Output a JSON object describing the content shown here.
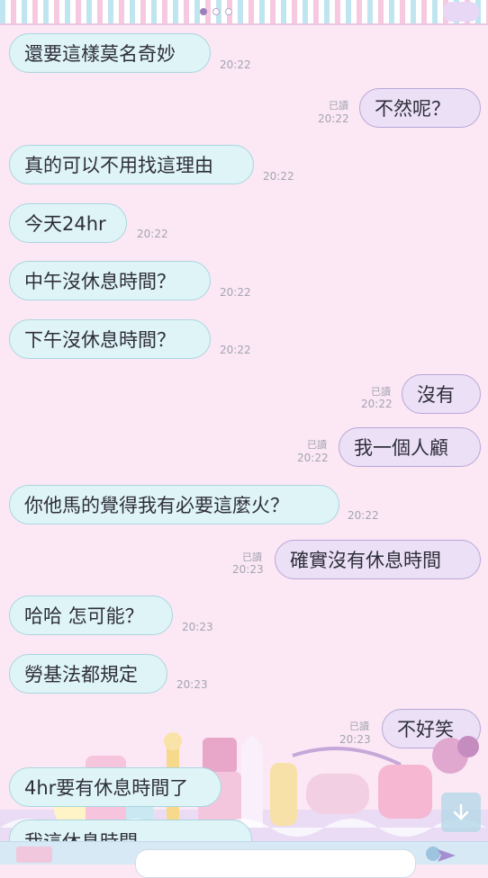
{
  "header": {
    "page_dots": 3,
    "active_dot": 0
  },
  "messages": [
    {
      "side": "in",
      "text": "還要這樣莫名奇妙",
      "time": "20:22"
    },
    {
      "side": "out",
      "text": "不然呢？",
      "read": "已讀",
      "time": "20:22"
    },
    {
      "side": "in",
      "text": "真的可以不用找這理由",
      "time": "20:22"
    },
    {
      "side": "in",
      "text": "今天24hr",
      "time": "20:22"
    },
    {
      "side": "in",
      "text": "中午沒休息時間？",
      "time": "20:22"
    },
    {
      "side": "in",
      "text": "下午沒休息時間？",
      "time": "20:22"
    },
    {
      "side": "out",
      "text": "沒有",
      "read": "已讀",
      "time": "20:22"
    },
    {
      "side": "out",
      "text": "我一個人顧",
      "read": "已讀",
      "time": "20:22"
    },
    {
      "side": "in",
      "text": "你他馬的覺得我有必要這麼火？",
      "time": "20:22"
    },
    {
      "side": "out",
      "text": "確實沒有休息時間",
      "read": "已讀",
      "time": "20:23"
    },
    {
      "side": "in",
      "text": "哈哈 怎可能？",
      "time": "20:23"
    },
    {
      "side": "in",
      "text": "勞基法都規定",
      "time": "20:23"
    },
    {
      "side": "out",
      "text": "不好笑",
      "read": "已讀",
      "time": "20:23"
    },
    {
      "side": "in",
      "text": "4hr要有休息時間了"
    },
    {
      "side": "in",
      "text": "我這休息時間..."
    }
  ],
  "icons": {
    "scroll_down": "arrow-down-icon",
    "send": "send-icon",
    "sticker": "sticker-icon"
  },
  "colors": {
    "background": "#fbe8f4",
    "incoming_bubble": "#dff4f7",
    "outgoing_bubble": "#ece0f7",
    "input_bar": "#d6e9f5"
  }
}
